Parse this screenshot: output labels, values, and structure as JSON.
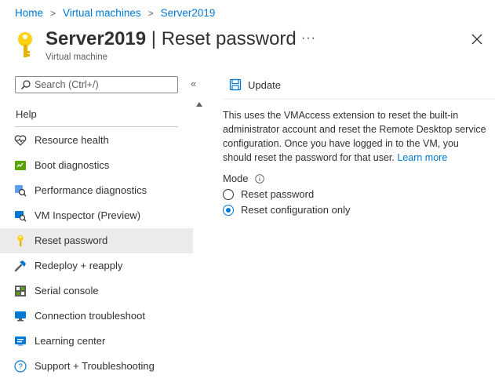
{
  "breadcrumb": [
    "Home",
    "Virtual machines",
    "Server2019"
  ],
  "header": {
    "title_bold": "Server2019",
    "title_rest": " | Reset password",
    "subtitle": "Virtual machine",
    "more": "···"
  },
  "sidebar": {
    "search_placeholder": "Search (Ctrl+/)",
    "collapse": "«",
    "section": "Help",
    "items": [
      {
        "label": "Resource health",
        "icon": "heart-icon"
      },
      {
        "label": "Boot diagnostics",
        "icon": "boot-diagnostics-icon"
      },
      {
        "label": "Performance diagnostics",
        "icon": "performance-diagnostics-icon"
      },
      {
        "label": "VM Inspector (Preview)",
        "icon": "vm-inspector-icon"
      },
      {
        "label": "Reset password",
        "icon": "key-icon",
        "selected": true
      },
      {
        "label": "Redeploy + reapply",
        "icon": "hammer-icon"
      },
      {
        "label": "Serial console",
        "icon": "serial-console-icon"
      },
      {
        "label": "Connection troubleshoot",
        "icon": "connection-troubleshoot-icon"
      },
      {
        "label": "Learning center",
        "icon": "learning-center-icon"
      },
      {
        "label": "Support + Troubleshooting",
        "icon": "question-icon"
      }
    ]
  },
  "toolbar": {
    "update_label": "Update"
  },
  "main": {
    "description": "This uses the VMAccess extension to reset the built-in administrator account and reset the Remote Desktop service configuration. Once you have logged in to the VM, you should reset the password for that user.",
    "learn_more": "Learn more",
    "mode_label": "Mode",
    "options": [
      {
        "label": "Reset password",
        "checked": false
      },
      {
        "label": "Reset configuration only",
        "checked": true
      }
    ]
  },
  "colors": {
    "accent": "#0078d4",
    "key": "#fcd116",
    "selected_bg": "#edebe9"
  }
}
